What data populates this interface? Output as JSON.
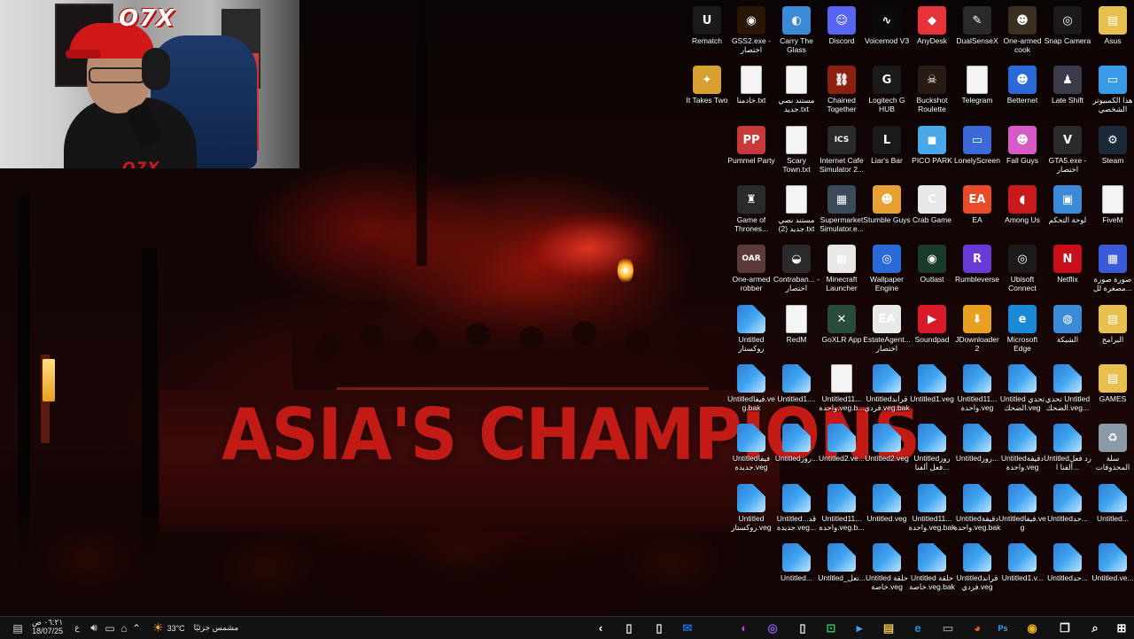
{
  "wallpaper": {
    "banner_text": "ASIA'S CHAMPIONS",
    "colors": {
      "banner_red": "#c21a14",
      "smoke_red": "#e61e0a"
    }
  },
  "webcam": {
    "logo": "O7X",
    "logo_bottom": "O7X"
  },
  "desktop": {
    "icons": [
      {
        "label": "Rematch",
        "icon": "unreal-engine-icon",
        "type": "app",
        "bg": "#1a1a1a",
        "glyph": "U",
        "col": 0,
        "row": 0
      },
      {
        "label": "GSS2.exe - اختصار",
        "icon": "gss2-icon",
        "type": "app",
        "bg": "#2a1408",
        "glyph": "◉",
        "col": 1,
        "row": 0
      },
      {
        "label": "Carry The Glass",
        "icon": "carry-the-glass-icon",
        "type": "app",
        "bg": "#3a8ad8",
        "glyph": "◐",
        "col": 2,
        "row": 0
      },
      {
        "label": "Discord",
        "icon": "discord-icon",
        "type": "app",
        "bg": "#5865f2",
        "glyph": "☺",
        "col": 3,
        "row": 0
      },
      {
        "label": "Voicemod V3",
        "icon": "voicemod-icon",
        "type": "app",
        "bg": "#0a0a0a",
        "glyph": "∿",
        "col": 4,
        "row": 0
      },
      {
        "label": "AnyDesk",
        "icon": "anydesk-icon",
        "type": "app",
        "bg": "#e8333a",
        "glyph": "◆",
        "col": 5,
        "row": 0
      },
      {
        "label": "DualSenseX",
        "icon": "dualsensex-icon",
        "type": "app",
        "bg": "#2a2a2a",
        "glyph": "✎",
        "col": 6,
        "row": 0
      },
      {
        "label": "One-armed cook",
        "icon": "one-armed-cook-icon",
        "type": "app",
        "bg": "#3a3020",
        "glyph": "☻",
        "col": 7,
        "row": 0
      },
      {
        "label": "Snap Camera",
        "icon": "snap-camera-icon",
        "type": "app",
        "bg": "#1a1a1a",
        "glyph": "◎",
        "col": 8,
        "row": 0
      },
      {
        "label": "Asus",
        "icon": "folder-icon",
        "type": "app",
        "bg": "#e8c050",
        "glyph": "▤",
        "col": 9,
        "row": 0
      },
      {
        "label": "It Takes Two",
        "icon": "it-takes-two-icon",
        "type": "app",
        "bg": "#d8a030",
        "glyph": "✦",
        "col": 0,
        "row": 1
      },
      {
        "label": "خادمنا.txt",
        "icon": "text-file-icon",
        "type": "doc",
        "col": 1,
        "row": 1
      },
      {
        "label": "مستند نصي جديد.txt",
        "icon": "text-file-icon",
        "type": "doc",
        "col": 2,
        "row": 1
      },
      {
        "label": "Chained Together",
        "icon": "chained-together-icon",
        "type": "app",
        "bg": "#8a2010",
        "glyph": "⛓",
        "col": 3,
        "row": 1
      },
      {
        "label": "Logitech G HUB",
        "icon": "logitech-ghub-icon",
        "type": "app",
        "bg": "#1a1a1a",
        "glyph": "G",
        "col": 4,
        "row": 1
      },
      {
        "label": "Buckshot Roulette",
        "icon": "buckshot-roulette-icon",
        "type": "app",
        "bg": "#2a1a14",
        "glyph": "☠",
        "col": 5,
        "row": 1
      },
      {
        "label": "Telegram",
        "icon": "text-file-icon",
        "type": "doc",
        "col": 6,
        "row": 1
      },
      {
        "label": "Betternet",
        "icon": "betternet-icon",
        "type": "app",
        "bg": "#2a6ad8",
        "glyph": "☻",
        "col": 7,
        "row": 1
      },
      {
        "label": "Late Shift",
        "icon": "late-shift-icon",
        "type": "app",
        "bg": "#3a3a4a",
        "glyph": "♟",
        "col": 8,
        "row": 1
      },
      {
        "label": "هذا الكمبيوتر الشخصي",
        "icon": "this-pc-icon",
        "type": "app",
        "bg": "#3a9ae8",
        "glyph": "▭",
        "col": 9,
        "row": 1
      },
      {
        "label": "Pummel Party",
        "icon": "pummel-party-icon",
        "type": "app",
        "bg": "#c83a3a",
        "glyph": "PP",
        "col": 0,
        "row": 2
      },
      {
        "label": "Scary Town.txt",
        "icon": "text-file-icon",
        "type": "doc",
        "col": 1,
        "row": 2
      },
      {
        "label": "Internet Cafe Simulator 2...",
        "icon": "internet-cafe-icon",
        "type": "app",
        "bg": "#2a2a2a",
        "glyph": "ICS",
        "col": 2,
        "row": 2
      },
      {
        "label": "Liar's Bar",
        "icon": "liars-bar-icon",
        "type": "app",
        "bg": "#1a1a1a",
        "glyph": "L",
        "col": 3,
        "row": 2
      },
      {
        "label": "PICO PARK",
        "icon": "pico-park-icon",
        "type": "app",
        "bg": "#4aa8e8",
        "glyph": "◼",
        "col": 4,
        "row": 2
      },
      {
        "label": "LonelyScreen",
        "icon": "lonelyscreen-icon",
        "type": "app",
        "bg": "#3a6ad8",
        "glyph": "▭",
        "col": 5,
        "row": 2
      },
      {
        "label": "Fall Guys",
        "icon": "fall-guys-icon",
        "type": "app",
        "bg": "#d85ac8",
        "glyph": "☻",
        "col": 6,
        "row": 2
      },
      {
        "label": "GTA5.exe - اختصار",
        "icon": "gta5-icon",
        "type": "app",
        "bg": "#2a2a2a",
        "glyph": "V",
        "col": 7,
        "row": 2
      },
      {
        "label": "Steam",
        "icon": "steam-icon",
        "type": "app",
        "bg": "#1b2838",
        "glyph": "⚙",
        "col": 8,
        "row": 2
      },
      {
        "label": "Game of Thrones...",
        "icon": "game-of-thrones-icon",
        "type": "app",
        "bg": "#2a2a2a",
        "glyph": "♜",
        "col": 0,
        "row": 3
      },
      {
        "label": "مستند نصي جديد (2).txt",
        "icon": "text-file-icon",
        "type": "doc",
        "col": 1,
        "row": 3
      },
      {
        "label": "Supermarket Simulator.e...",
        "icon": "supermarket-sim-icon",
        "type": "app",
        "bg": "#3a4a5a",
        "glyph": "▦",
        "col": 2,
        "row": 3
      },
      {
        "label": "Stumble Guys",
        "icon": "stumble-guys-icon",
        "type": "app",
        "bg": "#e8a030",
        "glyph": "☻",
        "col": 3,
        "row": 3
      },
      {
        "label": "Crab Game",
        "icon": "crab-game-icon",
        "type": "app",
        "bg": "#e8e8e8",
        "glyph": "C",
        "col": 4,
        "row": 3
      },
      {
        "label": "EA",
        "icon": "ea-icon",
        "type": "app",
        "bg": "#e84a2a",
        "glyph": "EA",
        "col": 5,
        "row": 3
      },
      {
        "label": "Among Us",
        "icon": "among-us-icon",
        "type": "app",
        "bg": "#c81a1a",
        "glyph": "◖",
        "col": 6,
        "row": 3
      },
      {
        "label": "لوحة التحكم",
        "icon": "control-panel-icon",
        "type": "app",
        "bg": "#3a8ad8",
        "glyph": "▣",
        "col": 7,
        "row": 3
      },
      {
        "label": "FiveM",
        "icon": "text-file-icon",
        "type": "doc",
        "col": 8,
        "row": 3
      },
      {
        "label": "One-armed robber",
        "icon": "one-armed-robber-icon",
        "type": "app",
        "bg": "#5a3a3a",
        "glyph": "OAR",
        "col": 0,
        "row": 4
      },
      {
        "label": "Contraban... - اختصار",
        "icon": "contraband-icon",
        "type": "app",
        "bg": "#2a2a2a",
        "glyph": "◒",
        "col": 1,
        "row": 4
      },
      {
        "label": "Minecraft Launcher",
        "icon": "minecraft-icon",
        "type": "app",
        "bg": "#e8e8e8",
        "glyph": "▩",
        "col": 2,
        "row": 4
      },
      {
        "label": "Wallpaper Engine",
        "icon": "wallpaper-engine-icon",
        "type": "app",
        "bg": "#2a6ad8",
        "glyph": "◎",
        "col": 3,
        "row": 4
      },
      {
        "label": "Outlast",
        "icon": "outlast-icon",
        "type": "app",
        "bg": "#1a3a2a",
        "glyph": "◉",
        "col": 4,
        "row": 4
      },
      {
        "label": "Rumbleverse",
        "icon": "rumbleverse-icon",
        "type": "app",
        "bg": "#6a3ad8",
        "glyph": "R",
        "col": 5,
        "row": 4
      },
      {
        "label": "Ubisoft Connect",
        "icon": "ubisoft-icon",
        "type": "app",
        "bg": "#1a1a1a",
        "glyph": "◎",
        "col": 6,
        "row": 4
      },
      {
        "label": "Netflix",
        "icon": "netflix-icon",
        "type": "app",
        "bg": "#c8101a",
        "glyph": "N",
        "col": 7,
        "row": 4
      },
      {
        "label": "صورة صورة مصغرة لل...",
        "icon": "image-file-icon",
        "type": "app",
        "bg": "#3a5ad8",
        "glyph": "▦",
        "col": 8,
        "row": 4
      },
      {
        "label": "Untitled روكستار",
        "icon": "vegas-file-icon",
        "type": "veg",
        "col": 0,
        "row": 5
      },
      {
        "label": "RedM",
        "icon": "text-file-icon",
        "type": "doc",
        "col": 1,
        "row": 5
      },
      {
        "label": "GoXLR App",
        "icon": "goxlr-icon",
        "type": "app",
        "bg": "#2a4a3a",
        "glyph": "✕",
        "col": 2,
        "row": 5
      },
      {
        "label": "EstateAgent... اختصار",
        "icon": "estate-agent-icon",
        "type": "app",
        "bg": "#e8e8e8",
        "glyph": "EA",
        "col": 3,
        "row": 5
      },
      {
        "label": "Soundpad",
        "icon": "soundpad-icon",
        "type": "app",
        "bg": "#d81a2a",
        "glyph": "▶",
        "col": 4,
        "row": 5
      },
      {
        "label": "JDownloader 2",
        "icon": "jdownloader-icon",
        "type": "app",
        "bg": "#e8a020",
        "glyph": "⬇",
        "col": 5,
        "row": 5
      },
      {
        "label": "Microsoft Edge",
        "icon": "edge-icon",
        "type": "app",
        "bg": "#1a8ad8",
        "glyph": "e",
        "col": 6,
        "row": 5
      },
      {
        "label": "الشبكة",
        "icon": "network-icon",
        "type": "app",
        "bg": "#3a8ad8",
        "glyph": "◍",
        "col": 7,
        "row": 5
      },
      {
        "label": "البرامج",
        "icon": "folder-icon",
        "type": "app",
        "bg": "#e8c050",
        "glyph": "▤",
        "col": 8,
        "row": 5
      },
      {
        "label": "Untitledفيفا.veg.bak",
        "icon": "vegas-file-icon",
        "type": "veg",
        "col": 0,
        "row": 6
      },
      {
        "label": "Untitled1....",
        "icon": "vegas-file-icon",
        "type": "veg",
        "col": 1,
        "row": 6
      },
      {
        "label": "Untitled11... واحدة.veg.b...",
        "icon": "text-file-icon",
        "type": "doc",
        "col": 2,
        "row": 6
      },
      {
        "label": "Untitledقراند فردي.veg.bak",
        "icon": "vegas-file-icon",
        "type": "veg",
        "col": 3,
        "row": 6
      },
      {
        "label": "Untitled1.veg",
        "icon": "vegas-file-icon",
        "type": "veg",
        "col": 4,
        "row": 6
      },
      {
        "label": "Untitled11... واحدة.veg",
        "icon": "vegas-file-icon",
        "type": "veg",
        "col": 5,
        "row": 6
      },
      {
        "label": "Untitled تحدي الضحك.veg",
        "icon": "vegas-file-icon",
        "type": "veg",
        "col": 6,
        "row": 6
      },
      {
        "label": "تحدي Untitled الضحك.veg...",
        "icon": "vegas-file-icon",
        "type": "veg",
        "col": 7,
        "row": 6
      },
      {
        "label": "GAMES",
        "icon": "folder-icon",
        "type": "app",
        "bg": "#e8c050",
        "glyph": "▤",
        "col": 8,
        "row": 6
      },
      {
        "label": "Untitledفيفا جديدة.veg",
        "icon": "vegas-file-icon",
        "type": "veg",
        "col": 0,
        "row": 7
      },
      {
        "label": "Untitledروز...",
        "icon": "vegas-file-icon",
        "type": "veg",
        "col": 1,
        "row": 7
      },
      {
        "label": "Untitled2.ve...",
        "icon": "vegas-file-icon",
        "type": "veg",
        "col": 2,
        "row": 7
      },
      {
        "label": "Untitled2.veg",
        "icon": "vegas-file-icon",
        "type": "veg",
        "col": 3,
        "row": 7
      },
      {
        "label": "Untitledروز فعل ألفنا...",
        "icon": "vegas-file-icon",
        "type": "veg",
        "col": 4,
        "row": 7
      },
      {
        "label": "Untitledروز...",
        "icon": "vegas-file-icon",
        "type": "veg",
        "col": 5,
        "row": 7
      },
      {
        "label": "Untitledدقيقة واحدة.veg",
        "icon": "vegas-file-icon",
        "type": "veg",
        "col": 6,
        "row": 7
      },
      {
        "label": "Untitledرد فعل ألفنا ا...",
        "icon": "vegas-file-icon",
        "type": "veg",
        "col": 7,
        "row": 7
      },
      {
        "label": "سلة المحذوفات",
        "icon": "recycle-bin-icon",
        "type": "app",
        "bg": "#8a9aa8",
        "glyph": "♻",
        "col": 8,
        "row": 7
      },
      {
        "label": "Untitled روكستار.veg",
        "icon": "vegas-file-icon",
        "type": "veg",
        "col": 0,
        "row": 8
      },
      {
        "label": "Untitledقد... جديدة.veg...",
        "icon": "vegas-file-icon",
        "type": "veg",
        "col": 1,
        "row": 8
      },
      {
        "label": "Untitled11... واحدة.veg.b...",
        "icon": "vegas-file-icon",
        "type": "veg",
        "col": 2,
        "row": 8
      },
      {
        "label": "Untitled.veg",
        "icon": "vegas-file-icon",
        "type": "veg",
        "col": 3,
        "row": 8
      },
      {
        "label": "Untitled11... واحدة.veg.bak",
        "icon": "vegas-file-icon",
        "type": "veg",
        "col": 4,
        "row": 8
      },
      {
        "label": "Untitledدقيقة واحدة.veg.bak",
        "icon": "vegas-file-icon",
        "type": "veg",
        "col": 5,
        "row": 8
      },
      {
        "label": "Untitledفيفا.veg",
        "icon": "vegas-file-icon",
        "type": "veg",
        "col": 6,
        "row": 8
      },
      {
        "label": "Untitledحد...",
        "icon": "vegas-file-icon",
        "type": "veg",
        "col": 7,
        "row": 8
      },
      {
        "label": "Untitled...",
        "icon": "vegas-file-icon",
        "type": "veg",
        "col": 8,
        "row": 8
      },
      {
        "label": "Untitled...",
        "icon": "vegas-file-icon",
        "type": "veg",
        "col": 1,
        "row": 9
      },
      {
        "label": "Untitled_تعل...",
        "icon": "vegas-file-icon",
        "type": "veg",
        "col": 2,
        "row": 9
      },
      {
        "label": "Untitled حلقة خاصة.veg",
        "icon": "vegas-file-icon",
        "type": "veg",
        "col": 3,
        "row": 9
      },
      {
        "label": "Untitled حلقة خاصة.veg.bak",
        "icon": "vegas-file-icon",
        "type": "veg",
        "col": 4,
        "row": 9
      },
      {
        "label": "Untitledقراند فردي.veg",
        "icon": "vegas-file-icon",
        "type": "veg",
        "col": 5,
        "row": 9
      },
      {
        "label": "Untitled1.v...",
        "icon": "vegas-file-icon",
        "type": "veg",
        "col": 6,
        "row": 9
      },
      {
        "label": "Untitledحد...",
        "icon": "vegas-file-icon",
        "type": "veg",
        "col": 7,
        "row": 9
      },
      {
        "label": "Untitled.ve...",
        "icon": "vegas-file-icon",
        "type": "veg",
        "col": 8,
        "row": 9
      }
    ]
  },
  "taskbar": {
    "time": "٠٦:٢١ ص",
    "date": "18/07/25",
    "language": "ع",
    "weather_temp": "33°C",
    "weather_text": "مشمس جزئيًا",
    "apps": [
      {
        "name": "search-icon",
        "glyph": "⌕",
        "color": "#ffffff"
      },
      {
        "name": "task-view-icon",
        "glyph": "❐",
        "color": "#ffffff"
      },
      {
        "name": "windows-start-icon",
        "glyph": "⊞",
        "color": "#ffffff"
      },
      {
        "name": "photoshop-icon",
        "glyph": "Ps",
        "color": "#31a8ff"
      },
      {
        "name": "chrome-icon",
        "glyph": "◉",
        "color": "#e8b020"
      },
      {
        "name": "firefox-icon",
        "glyph": "◕",
        "color": "#e86020"
      },
      {
        "name": "terminal-icon",
        "glyph": "▭",
        "color": "#8a8a8a"
      },
      {
        "name": "edge-taskbar-icon",
        "glyph": "e",
        "color": "#1a8ad8"
      },
      {
        "name": "file-explorer-icon",
        "glyph": "▤",
        "color": "#e8c050"
      },
      {
        "name": "vegas-taskbar-icon",
        "glyph": "▸",
        "color": "#3fa4f0"
      },
      {
        "name": "xbox-icon",
        "glyph": "⊡",
        "color": "#20c060"
      },
      {
        "name": "notepad-icon",
        "glyph": "▯",
        "color": "#e8e8e8"
      },
      {
        "name": "obs-icon",
        "glyph": "◎",
        "color": "#8a5ae8"
      },
      {
        "name": "voice-app-icon",
        "glyph": "◐",
        "color": "#c040e8"
      },
      {
        "name": "outlook-icon",
        "glyph": "✉",
        "color": "#1a6ad8"
      },
      {
        "name": "document-icon",
        "glyph": "▯",
        "color": "#e8e8e8"
      },
      {
        "name": "document2-icon",
        "glyph": "▯",
        "color": "#e8e8e8"
      },
      {
        "name": "back-icon",
        "glyph": "‹",
        "color": "#ffffff"
      }
    ]
  }
}
